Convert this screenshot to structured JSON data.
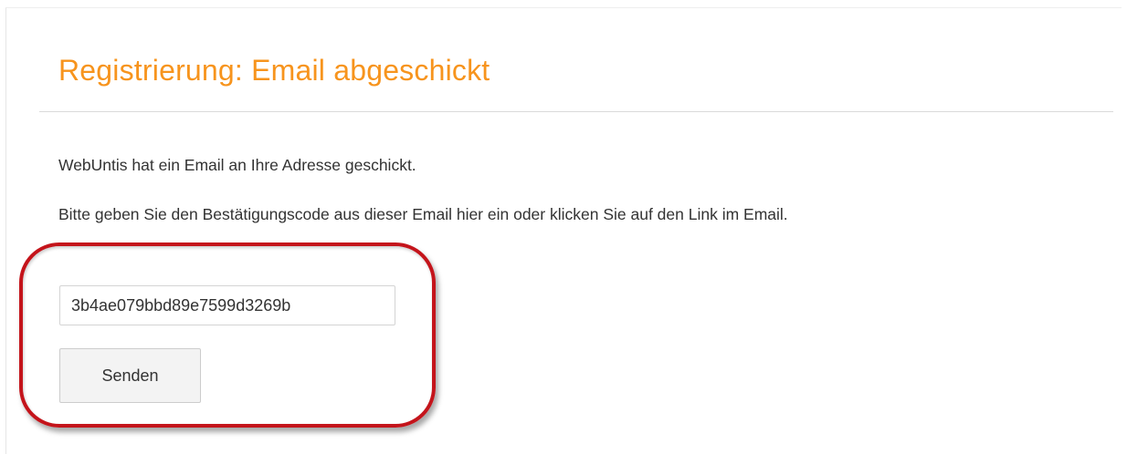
{
  "page": {
    "title": "Registrierung: Email abgeschickt",
    "message_sent": "WebUntis hat ein Email an Ihre Adresse geschickt.",
    "instruction": "Bitte geben Sie den Bestätigungscode aus dieser Email hier ein oder klicken Sie auf den Link im Email."
  },
  "form": {
    "code_value": "3b4ae079bbd89e7599d3269b",
    "submit_label": "Senden"
  },
  "colors": {
    "title": "#f7941d",
    "highlight": "#c4141b"
  }
}
